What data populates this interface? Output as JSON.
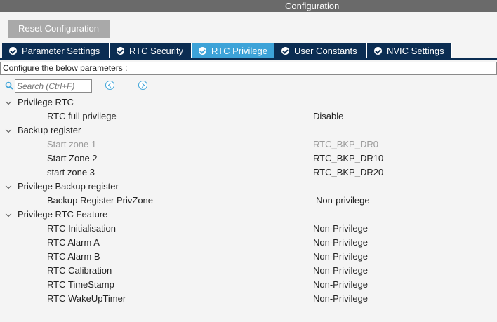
{
  "window": {
    "title": "Configuration"
  },
  "toolbar": {
    "reset_label": "Reset Configuration"
  },
  "tabs": [
    {
      "label": "Parameter Settings",
      "active": false
    },
    {
      "label": "RTC Security",
      "active": false
    },
    {
      "label": "RTC Privilege",
      "active": true
    },
    {
      "label": "User Constants",
      "active": false
    },
    {
      "label": "NVIC Settings",
      "active": false
    }
  ],
  "config_prompt": "Configure the below parameters :",
  "search": {
    "placeholder": "Search (Ctrl+F)"
  },
  "groups": [
    {
      "label": "Privilege RTC",
      "params": [
        {
          "name": "RTC full privilege",
          "value": "Disable",
          "disabled": false
        }
      ]
    },
    {
      "label": "Backup register",
      "params": [
        {
          "name": "Start zone 1",
          "value": "RTC_BKP_DR0",
          "disabled": true
        },
        {
          "name": "Start Zone 2",
          "value": "RTC_BKP_DR10",
          "disabled": false
        },
        {
          "name": "start zone 3",
          "value": "RTC_BKP_DR20",
          "disabled": false
        }
      ]
    },
    {
      "label": "Privilege Backup register",
      "params": [
        {
          "name": "Backup Register PrivZone",
          "value": "Non-privilege",
          "disabled": false
        }
      ]
    },
    {
      "label": "Privilege RTC Feature",
      "params": [
        {
          "name": "RTC Initialisation",
          "value": "Non-Privilege",
          "disabled": false
        },
        {
          "name": "RTC Alarm A",
          "value": "Non-Privilege",
          "disabled": false
        },
        {
          "name": "RTC Alarm B",
          "value": "Non-Privilege",
          "disabled": false
        },
        {
          "name": "RTC Calibration",
          "value": "Non-Privilege",
          "disabled": false
        },
        {
          "name": "RTC TimeStamp",
          "value": "Non-Privilege",
          "disabled": false
        },
        {
          "name": "RTC WakeUpTimer",
          "value": "Non-Privilege",
          "disabled": false
        }
      ]
    }
  ],
  "colors": {
    "accent": "#3da3d8",
    "tab_bg": "#0b2d52",
    "title_bg": "#6a6a6a"
  }
}
